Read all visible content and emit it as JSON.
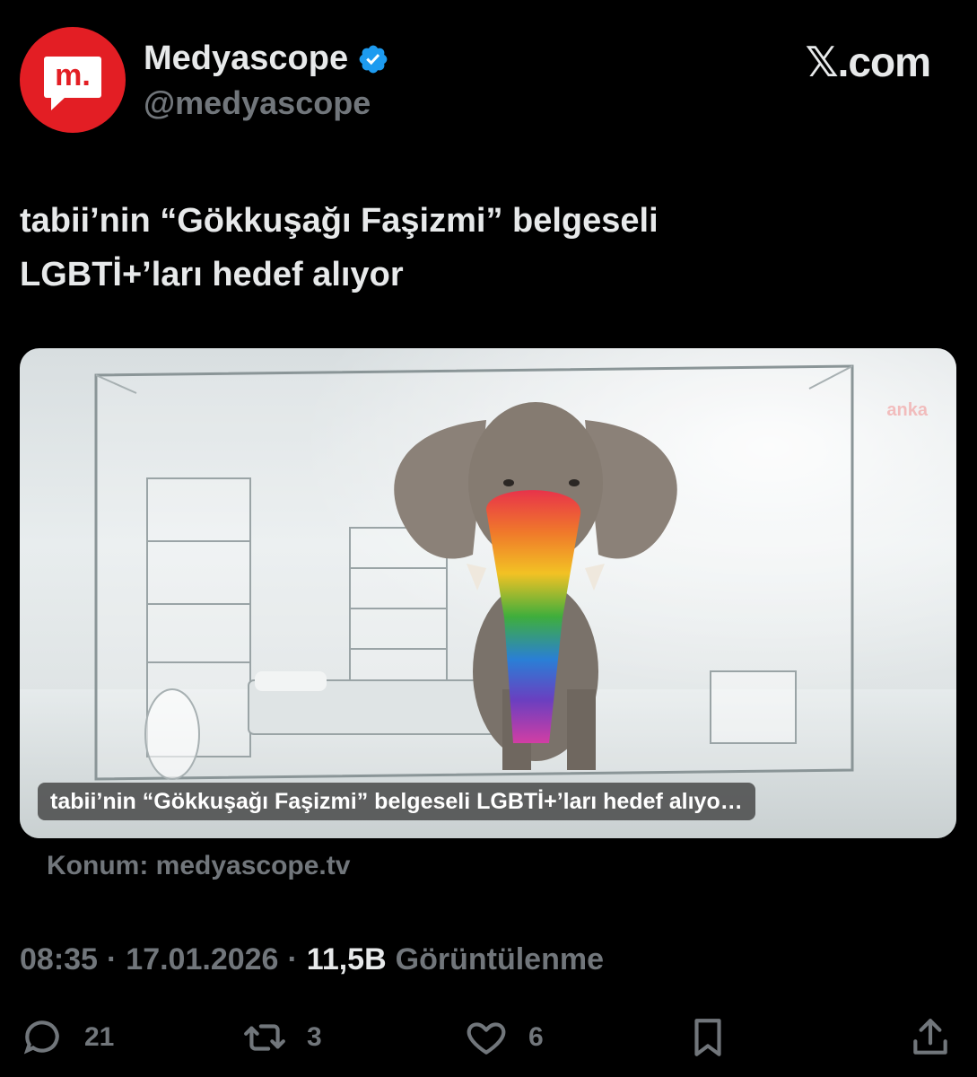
{
  "author": {
    "name": "Medyascope",
    "handle": "@medyascope",
    "avatar_letter": "m.",
    "verified": true
  },
  "brand": "𝕏.com",
  "tweet": {
    "text_line1": "tabii’nin “Gökkuşağı Faşizmi” belgeseli",
    "text_line2": "LGBTİ+’ları hedef alıyor"
  },
  "card": {
    "caption": "tabii’nin “Gökkuşağı Faşizmi” belgeseli LGBTİ+’ları hedef alıyo…",
    "watermark": "anka",
    "source": "Konum: medyascope.tv"
  },
  "meta": {
    "time": "08:35",
    "separator": "·",
    "date": "17.01.2026",
    "views_count": "11,5B",
    "views_label": "Görüntülenme"
  },
  "actions": {
    "replies": "21",
    "reposts": "3",
    "likes": "6"
  },
  "colors": {
    "background": "#000000",
    "primary_text": "#e7e9ea",
    "secondary_text": "#71767b",
    "avatar_red": "#e31e24",
    "verified_blue": "#1d9bf0"
  }
}
